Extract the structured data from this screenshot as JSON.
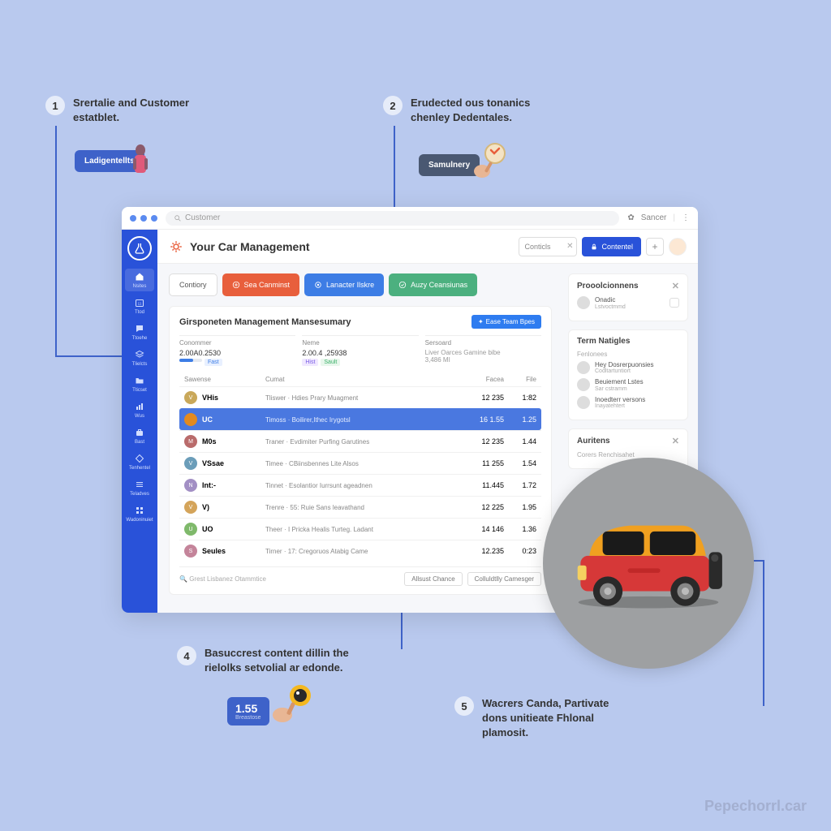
{
  "callouts": {
    "c1": {
      "num": "1",
      "text": "Srertalie and Customer estatblet."
    },
    "c2": {
      "num": "2",
      "text": "Erudected ous tonanics chenley Dedentales."
    },
    "c4": {
      "num": "4",
      "text": "Basuccrest content dillin the rielolks setvolial ar edonde."
    },
    "c5": {
      "num": "5",
      "text": "Wacrers Canda, Partivate dons unitieate Fhlonal plamosit."
    }
  },
  "tags": {
    "t1": "Ladigentellts",
    "t2": "Samulnery"
  },
  "browser": {
    "placeholder": "Customer",
    "settings_label": "Sancer"
  },
  "header": {
    "title": "Your Car Management",
    "search_placeholder": "Conticls",
    "primary_btn": "Contentel"
  },
  "actions": {
    "a0": "Contiory",
    "a1": "Sea Canminst",
    "a2": "Lanacter Ilskre",
    "a3": "Auzy Ceansiunas"
  },
  "panel": {
    "title": "Girsponeten Management Mansesumary",
    "cta": "Ease Team Bpes",
    "filters": {
      "f1_label": "Conommer",
      "f1_val": "2.00A0.2530",
      "f2_label": "Neme",
      "f2_val": "2.00.4 ,25938",
      "f3_label": "Sersoard",
      "f3_val": "Liver  Oarces Gamine bibe",
      "f3_val2": "3,486 MI"
    },
    "th": {
      "c1": "Sawense",
      "c2": "Cumat",
      "c3": "Facea",
      "c4": "File"
    },
    "rows": [
      {
        "avatar": "V",
        "color": "#c9a85a",
        "name": "VHis",
        "desc": "Tliswer · Hdies Prary Muagment",
        "n1": "12 235",
        "n2": "1:82"
      },
      {
        "avatar": "U",
        "color": "#e38a1f",
        "name": "UC",
        "desc": "Timoss · Boilirer,Ithec Irygotsl",
        "n1": "16 1.55",
        "n2": "1.25",
        "selected": true
      },
      {
        "avatar": "M",
        "color": "#b96b6b",
        "name": "M0s",
        "desc": "Traner · Evdimiter Purfing Garutines",
        "n1": "12 235",
        "n2": "1.44"
      },
      {
        "avatar": "V",
        "color": "#6b9db9",
        "name": "VSsae",
        "desc": "Timee · CBiinsbennes Lite Alsos",
        "n1": "11 255",
        "n2": "1.54"
      },
      {
        "avatar": "N",
        "color": "#a28fc4",
        "name": "Int:-",
        "desc": "Tinnet · Esolantior Iurrsunt ageadnen",
        "n1": "11.445",
        "n2": "1.72"
      },
      {
        "avatar": "V",
        "color": "#d4a45a",
        "name": "V)",
        "desc": "Trenre · 55: Ruie Sans leavathand",
        "n1": "12 225",
        "n2": "1.95"
      },
      {
        "avatar": "U",
        "color": "#7fb96b",
        "name": "UO",
        "desc": "Theer · I Pricka Healis Turteg. Ladant",
        "n1": "14 146",
        "n2": "1.36"
      },
      {
        "avatar": "S",
        "color": "#c4849a",
        "name": "Seules",
        "desc": "Tirner · 17: Cregoruos Atabig Came",
        "n1": "12.235",
        "n2": "0:23"
      }
    ],
    "footer_search": "Grest Lisbanez Otammtice",
    "footer_b1": "Allsust Chance",
    "footer_b2": "Colluldtlly Camesger"
  },
  "right": {
    "card1_title": "Prooolcionnens",
    "card1_name": "Onadic",
    "card1_sub": "Lstvoctmmd",
    "card2_title": "Term Natigles",
    "card2_sub": "Fenlonees",
    "card2_items": [
      {
        "name": "Hey Dosrerpuonsies",
        "sub": "Codltartuntiort"
      },
      {
        "name": "Beuiement Lstes",
        "sub": "Sar cstramm"
      },
      {
        "name": "Inoedterr versons",
        "sub": "Inayatehtert"
      }
    ],
    "card3_title": "Auritens",
    "card3_sub": "Corers Renchisahet"
  },
  "stat": {
    "value": "1.55",
    "sub": "Breastose"
  },
  "watermark": "Pepechorrl.car"
}
